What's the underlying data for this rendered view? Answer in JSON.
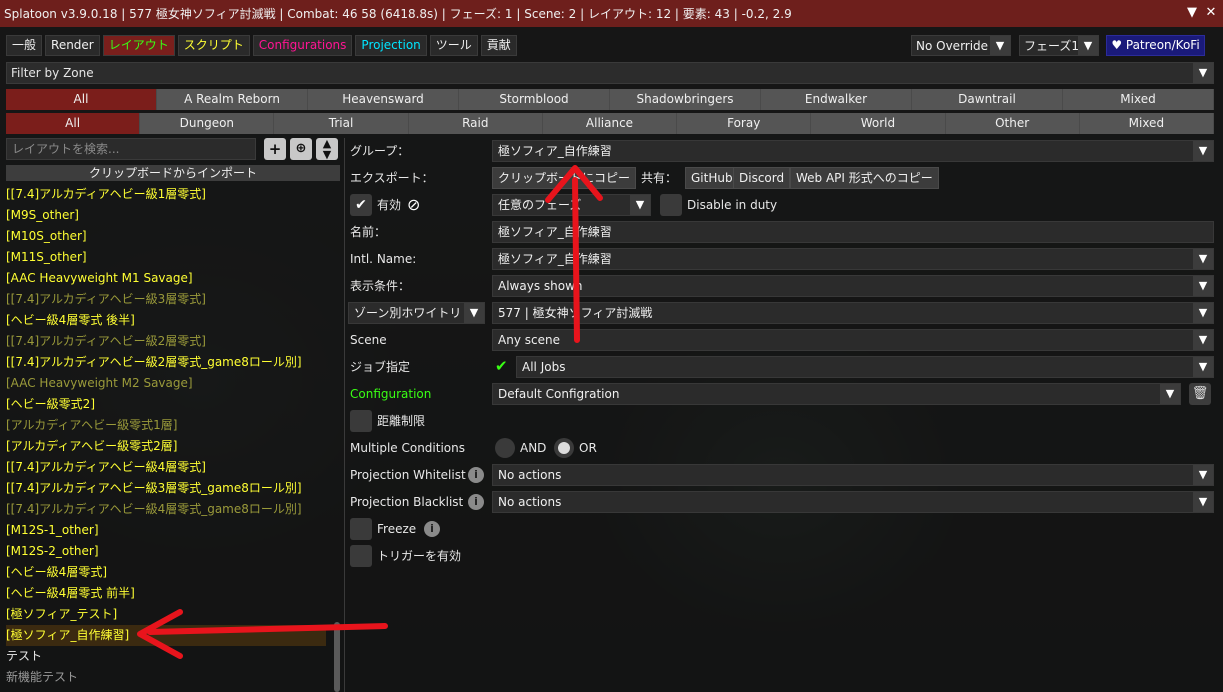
{
  "titlebar": {
    "text": "Splatoon v3.9.0.18 | 577 極女神ソフィア討滅戦 | Combat: 46 58 (6418.8s) | フェーズ: 1 | Scene: 2 | レイアウト: 12 | 要素: 43 | -0.2, 2.9"
  },
  "tabs": [
    "一般",
    "Render",
    "レイアウト",
    "スクリプト",
    "Configurations",
    "Projection",
    "ツール",
    "貢献"
  ],
  "override_combo": "No Override",
  "phase_combo": "フェーズ1",
  "patreon_label": "♥ Patreon/KoFi",
  "filter_label": "Filter by Zone",
  "expansions": [
    "All",
    "A Realm Reborn",
    "Heavensward",
    "Stormblood",
    "Shadowbringers",
    "Endwalker",
    "Dawntrail",
    "Mixed"
  ],
  "content_types": [
    "All",
    "Dungeon",
    "Trial",
    "Raid",
    "Alliance",
    "Foray",
    "World",
    "Other",
    "Mixed"
  ],
  "search_placeholder": "レイアウトを検索...",
  "import_label": "クリップボードからインポート",
  "layouts": [
    {
      "name": "[[7.4]アルカディアヘビー級1層零式]",
      "state": "on"
    },
    {
      "name": "[M9S_other]",
      "state": "on"
    },
    {
      "name": "[M10S_other]",
      "state": "on"
    },
    {
      "name": "[M11S_other]",
      "state": "on"
    },
    {
      "name": "[AAC Heavyweight M1 Savage]",
      "state": "on"
    },
    {
      "name": "[[7.4]アルカディアヘビー級3層零式]",
      "state": "off"
    },
    {
      "name": "[ヘビー級4層零式 後半]",
      "state": "on"
    },
    {
      "name": "[[7.4]アルカディアヘビー級2層零式]",
      "state": "off"
    },
    {
      "name": "[[7.4]アルカディアヘビー級2層零式_game8ロール別]",
      "state": "on"
    },
    {
      "name": "[AAC Heavyweight M2 Savage]",
      "state": "off"
    },
    {
      "name": "[ヘビー級零式2]",
      "state": "on"
    },
    {
      "name": "[アルカディアヘビー級零式1層]",
      "state": "off"
    },
    {
      "name": "[アルカディアヘビー級零式2層]",
      "state": "on"
    },
    {
      "name": "[[7.4]アルカディアヘビー級4層零式]",
      "state": "on"
    },
    {
      "name": "[[7.4]アルカディアヘビー級3層零式_game8ロール別]",
      "state": "on"
    },
    {
      "name": "[[7.4]アルカディアヘビー級4層零式_game8ロール別]",
      "state": "off"
    },
    {
      "name": "[M12S-1_other]",
      "state": "on"
    },
    {
      "name": "[M12S-2_other]",
      "state": "on"
    },
    {
      "name": "[ヘビー級4層零式]",
      "state": "on"
    },
    {
      "name": "[ヘビー級4層零式 前半]",
      "state": "on"
    },
    {
      "name": "[極ソフィア_テスト]",
      "state": "on"
    },
    {
      "name": "[極ソフィア_自作練習]",
      "state": "selected"
    },
    {
      "name": "テスト",
      "state": "white"
    },
    {
      "name": "新機能テスト",
      "state": "grey"
    }
  ],
  "props": {
    "group_label": "グループ：",
    "group_value": "極ソフィア_自作練習",
    "export_label": "エクスポート：",
    "copy_clipboard": "クリップボードにコピー",
    "share_label": "共有：",
    "github": "GitHub",
    "discord": "Discord",
    "webapi": "Web API 形式へのコピー",
    "enabled_label": "有効",
    "phase_value": "任意のフェーズ",
    "disable_in_duty": "Disable in duty",
    "name_label": "名前：",
    "name_value": "極ソフィア_自作練習",
    "intl_label": "Intl. Name:",
    "intl_value": "極ソフィア_自作練習",
    "display_cond_label": "表示条件：",
    "display_cond_value": "Always shown",
    "zone_mode": "ゾーン別ホワイトリ",
    "zone_value": "577 | 極女神ソフィア討滅戦",
    "scene_label": "Scene",
    "scene_value": "Any scene",
    "job_label": "ジョブ指定",
    "job_value": "All Jobs",
    "config_label": "Configuration",
    "config_value": "Default Configration",
    "distance_label": "距離制限",
    "multi_label": "Multiple Conditions",
    "and_label": "AND",
    "or_label": "OR",
    "proj_white_label": "Projection Whitelist",
    "proj_white_value": "No actions",
    "proj_black_label": "Projection Blacklist",
    "proj_black_value": "No actions",
    "freeze_label": "Freeze",
    "trigger_label": "トリガーを有効"
  },
  "colors": {
    "accent_red": "#7b1e1b",
    "title_red": "#6e1f1c",
    "annotation_arrow": "#e8141c",
    "enabled_yellow": "#ffff33",
    "config_green": "#39ff14"
  }
}
